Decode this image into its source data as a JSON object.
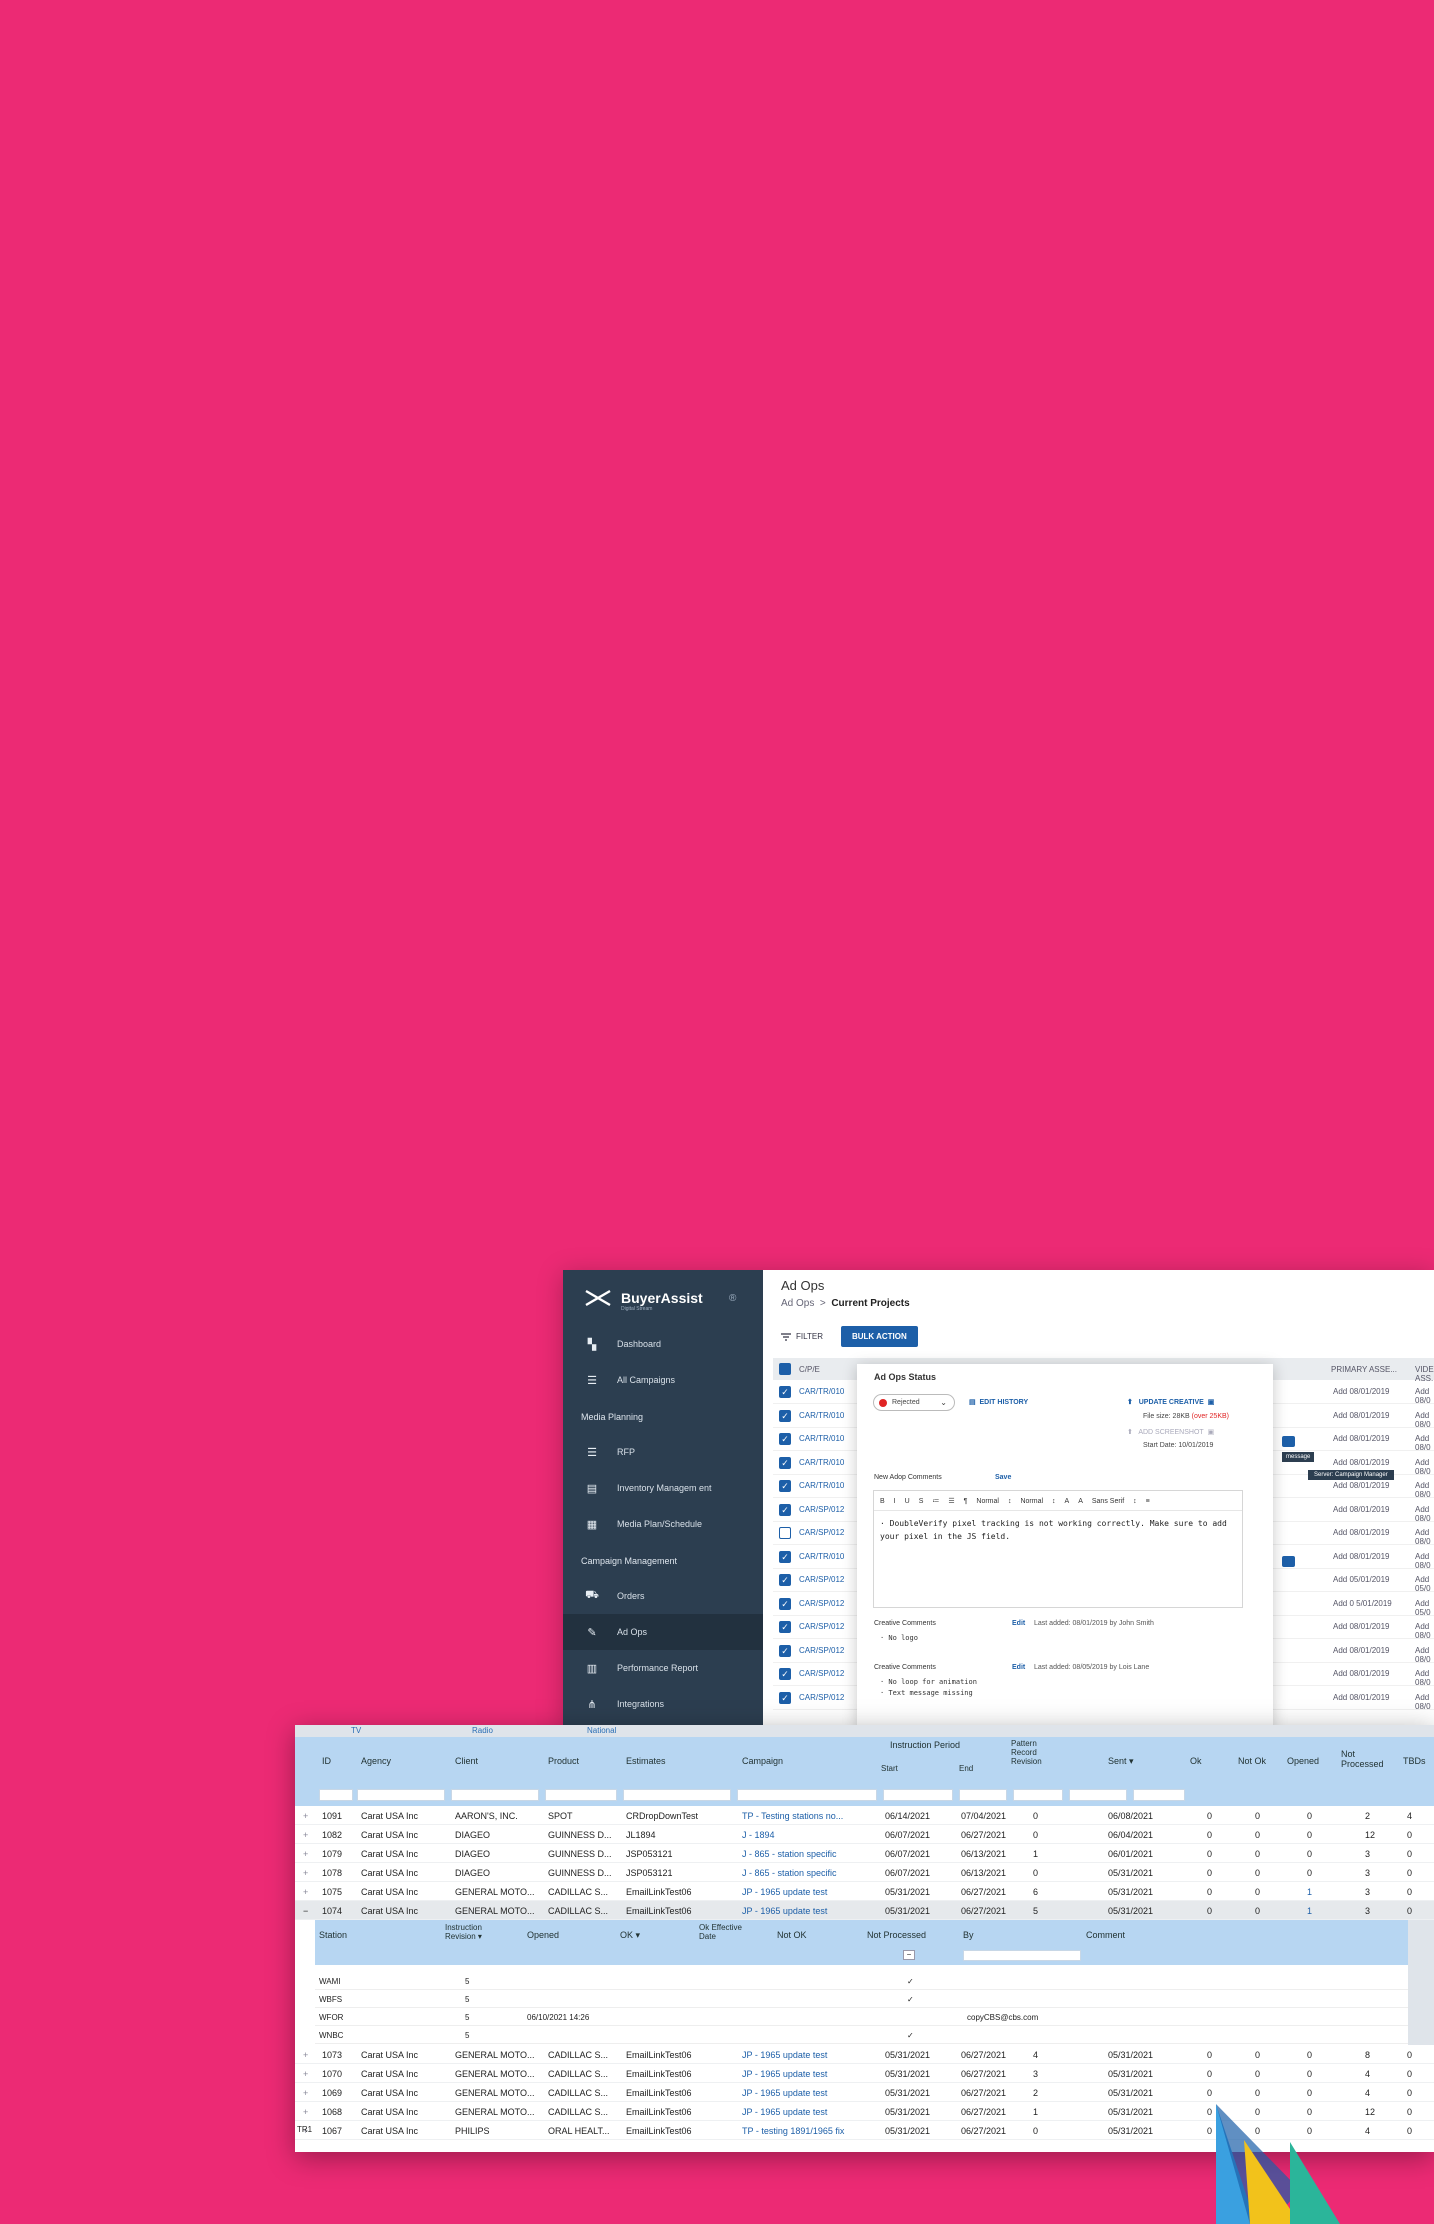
{
  "colors": {
    "background": "#ec2a74",
    "sidebar": "#2c3e50",
    "accent": "#1d5fa8",
    "header_blue": "#b7d6f2",
    "rejected": "#e02424"
  },
  "back_window": {
    "brand": {
      "name": "BuyerAssist",
      "sub": "Digital Stream",
      "help": "®"
    },
    "sidebar": {
      "items_top": [
        {
          "label": "Dashboard",
          "icon": "dashboard-icon",
          "glyph": "▚"
        },
        {
          "label": "All Campaigns",
          "icon": "list-icon",
          "glyph": "☰"
        }
      ],
      "section_planning": "Media Planning",
      "items_planning": [
        {
          "label": "RFP",
          "icon": "list-icon",
          "glyph": "☰"
        },
        {
          "label": "Inventory Managem ent",
          "icon": "clipboard-icon",
          "glyph": "▤"
        },
        {
          "label": "Media Plan/Schedule",
          "icon": "calendar-icon",
          "glyph": "▦"
        }
      ],
      "section_campaign": "Campaign Management",
      "items_campaign": [
        {
          "label": "Orders",
          "icon": "basket-icon",
          "glyph": "⛟"
        },
        {
          "label": "Ad Ops",
          "icon": "adops-icon",
          "glyph": "✎"
        },
        {
          "label": "Performance Report",
          "icon": "report-icon",
          "glyph": "▥"
        },
        {
          "label": "Integrations",
          "icon": "integrations-icon",
          "glyph": "⋔"
        }
      ]
    },
    "title": "Ad Ops",
    "breadcrumb": {
      "parent": "Ad Ops",
      "separator": ">",
      "current": "Current Projects"
    },
    "filter_label": "FILTER",
    "bulk_action_label": "BULK ACTION",
    "columns": {
      "cp": "C/P/E",
      "primary": "PRIMARY ASSE...",
      "video": "VIDEO ASS..."
    },
    "rows": [
      {
        "id": "CAR/TR/010",
        "checked": true,
        "d1": "Add 08/01/2019",
        "d2": "Add 08/0"
      },
      {
        "id": "CAR/TR/010",
        "checked": true,
        "d1": "Add 08/01/2019",
        "d2": "Add 08/0"
      },
      {
        "id": "CAR/TR/010",
        "checked": true,
        "d1": "Add 08/01/2019",
        "d2": "Add 08/0"
      },
      {
        "id": "CAR/TR/010",
        "checked": true,
        "d1": "Add 08/01/2019",
        "d2": "Add 08/0"
      },
      {
        "id": "CAR/TR/010",
        "checked": true,
        "d1": "Add 08/01/2019",
        "d2": "Add 08/0"
      },
      {
        "id": "CAR/SP/012",
        "checked": true,
        "d1": "Add 08/01/2019",
        "d2": "Add 08/0"
      },
      {
        "id": "CAR/SP/012",
        "checked": false,
        "d1": "Add 08/01/2019",
        "d2": "Add 08/0"
      },
      {
        "id": "CAR/TR/010",
        "checked": true,
        "d1": "Add 08/01/2019",
        "d2": "Add 08/0"
      },
      {
        "id": "CAR/SP/012",
        "checked": true,
        "d1": "Add 05/01/2019",
        "d2": "Add 05/0"
      },
      {
        "id": "CAR/SP/012",
        "checked": true,
        "d1": "Add 0 5/01/2019",
        "d2": "Add 05/0"
      },
      {
        "id": "CAR/SP/012",
        "checked": true,
        "d1": "Add 08/01/2019",
        "d2": "Add 08/0"
      },
      {
        "id": "CAR/SP/012",
        "checked": true,
        "d1": "Add 08/01/2019",
        "d2": "Add 08/0"
      },
      {
        "id": "CAR/SP/012",
        "checked": true,
        "d1": "Add 08/01/2019",
        "d2": "Add 08/0"
      },
      {
        "id": "CAR/SP/012",
        "checked": true,
        "d1": "Add 08/01/2019",
        "d2": "Add 08/0"
      }
    ],
    "tooltip_message": "message",
    "tooltip_server": "Server: Campaign Manager",
    "popup": {
      "title": "Ad Ops Status",
      "status": "Rejected",
      "edit_history": "EDIT HISTORY",
      "update_creative": "UPDATE CREATIVE",
      "file_size": "File size: 28KB",
      "file_size_over": "(over 25KB)",
      "add_screenshot": "ADD SCREENSHOT",
      "start_date": "Start Date: 10/01/2019",
      "new_comments_label": "New Adop Comments",
      "save_label": "Save",
      "editor_toolbar": [
        "B",
        "I",
        "U",
        "S",
        "≔",
        "☰",
        "¶",
        "Normal",
        "↕",
        "Normal",
        "↕",
        "A",
        "A",
        "Sans Serif",
        "↕",
        "≡"
      ],
      "editor_text": "· DoubleVerify pixel tracking is not working correctly. Make sure to add your pixel in the JS field.",
      "creative_comments": [
        {
          "label": "Creative Comments",
          "edit": "Edit",
          "added": "Last added: 08/01/2019 by John Smith",
          "items": [
            "· No logo"
          ]
        },
        {
          "label": "Creative Comments",
          "edit": "Edit",
          "added": "Last added: 08/05/2019 by Lois Lane",
          "items": [
            "· No loop for animation",
            "· Text message missing"
          ]
        }
      ]
    }
  },
  "front_window": {
    "tabs": [
      "TV",
      "Radio",
      "National"
    ],
    "headers": {
      "id": "ID",
      "agency": "Agency",
      "client": "Client",
      "product": "Product",
      "estimates": "Estimates",
      "campaign": "Campaign",
      "instruction_period": "Instruction Period",
      "start": "Start",
      "end": "End",
      "pattern": "Pattern Record Revision",
      "sent": "Sent ▾",
      "ok": "Ok",
      "not_ok": "Not Ok",
      "opened": "Opened",
      "not_processed": "Not Processed",
      "tbds": "TBDs"
    },
    "rows_top": [
      {
        "id": "1091",
        "agency": "Carat USA Inc",
        "client": "AARON'S, INC.",
        "product": "SPOT",
        "est": "CRDropDownTest",
        "campaign": "TP - Testing stations no...",
        "start": "06/14/2021",
        "end": "07/04/2021",
        "pattern": "0",
        "sent": "06/08/2021",
        "ok": "0",
        "notok": "0",
        "opened": "0",
        "notproc": "2",
        "tbds": "4"
      },
      {
        "id": "1082",
        "agency": "Carat USA Inc",
        "client": "DIAGEO",
        "product": "GUINNESS D...",
        "est": "JL1894",
        "campaign": "J - 1894",
        "start": "06/07/2021",
        "end": "06/27/2021",
        "pattern": "0",
        "sent": "06/04/2021",
        "ok": "0",
        "notok": "0",
        "opened": "0",
        "notproc": "12",
        "tbds": "0"
      },
      {
        "id": "1079",
        "agency": "Carat USA Inc",
        "client": "DIAGEO",
        "product": "GUINNESS D...",
        "est": "JSP053121",
        "campaign": "J - 865 - station specific",
        "start": "06/07/2021",
        "end": "06/13/2021",
        "pattern": "1",
        "sent": "06/01/2021",
        "ok": "0",
        "notok": "0",
        "opened": "0",
        "notproc": "3",
        "tbds": "0"
      },
      {
        "id": "1078",
        "agency": "Carat USA Inc",
        "client": "DIAGEO",
        "product": "GUINNESS D...",
        "est": "JSP053121",
        "campaign": "J - 865 - station specific",
        "start": "06/07/2021",
        "end": "06/13/2021",
        "pattern": "0",
        "sent": "05/31/2021",
        "ok": "0",
        "notok": "0",
        "opened": "0",
        "notproc": "3",
        "tbds": "0"
      },
      {
        "id": "1075",
        "agency": "Carat USA Inc",
        "client": "GENERAL MOTO...",
        "product": "CADILLAC S...",
        "est": "EmailLinkTest06",
        "campaign": "JP - 1965 update test",
        "start": "05/31/2021",
        "end": "06/27/2021",
        "pattern": "6",
        "sent": "05/31/2021",
        "ok": "0",
        "notok": "0",
        "opened": "1",
        "notproc": "3",
        "tbds": "0"
      },
      {
        "id": "1074",
        "agency": "Carat USA Inc",
        "client": "GENERAL MOTO...",
        "product": "CADILLAC S...",
        "est": "EmailLinkTest06",
        "campaign": "JP - 1965 update test",
        "start": "05/31/2021",
        "end": "06/27/2021",
        "pattern": "5",
        "sent": "05/31/2021",
        "ok": "0",
        "notok": "0",
        "opened": "1",
        "notproc": "3",
        "tbds": "0"
      }
    ],
    "sub_headers": {
      "station": "Station",
      "revision": "Instruction Revision ▾",
      "opened": "Opened",
      "ok": "OK ▾",
      "ok_effective": "Ok Effective Date",
      "not_ok": "Not OK",
      "not_processed": "Not Processed",
      "by": "By",
      "comment": "Comment"
    },
    "sub_rows": [
      {
        "station": "WAMI",
        "rev": "5",
        "opened": "",
        "np": "✓",
        "by": ""
      },
      {
        "station": "WBFS",
        "rev": "5",
        "opened": "",
        "np": "✓",
        "by": ""
      },
      {
        "station": "WFOR",
        "rev": "5",
        "opened": "06/10/2021 14:26",
        "np": "",
        "by": "copyCBS@cbs.com"
      },
      {
        "station": "WNBC",
        "rev": "5",
        "opened": "",
        "np": "✓",
        "by": ""
      }
    ],
    "rows_bottom": [
      {
        "id": "1073",
        "agency": "Carat USA Inc",
        "client": "GENERAL MOTO...",
        "product": "CADILLAC S...",
        "est": "EmailLinkTest06",
        "campaign": "JP - 1965 update test",
        "start": "05/31/2021",
        "end": "06/27/2021",
        "pattern": "4",
        "sent": "05/31/2021",
        "ok": "0",
        "notok": "0",
        "opened": "0",
        "notproc": "8",
        "tbds": "0"
      },
      {
        "id": "1070",
        "agency": "Carat USA Inc",
        "client": "GENERAL MOTO...",
        "product": "CADILLAC S...",
        "est": "EmailLinkTest06",
        "campaign": "JP - 1965 update test",
        "start": "05/31/2021",
        "end": "06/27/2021",
        "pattern": "3",
        "sent": "05/31/2021",
        "ok": "0",
        "notok": "0",
        "opened": "0",
        "notproc": "4",
        "tbds": "0"
      },
      {
        "id": "1069",
        "agency": "Carat USA Inc",
        "client": "GENERAL MOTO...",
        "product": "CADILLAC S...",
        "est": "EmailLinkTest06",
        "campaign": "JP - 1965 update test",
        "start": "05/31/2021",
        "end": "06/27/2021",
        "pattern": "2",
        "sent": "05/31/2021",
        "ok": "0",
        "notok": "0",
        "opened": "0",
        "notproc": "4",
        "tbds": "0"
      },
      {
        "id": "1068",
        "agency": "Carat USA Inc",
        "client": "GENERAL MOTO...",
        "product": "CADILLAC S...",
        "est": "EmailLinkTest06",
        "campaign": "JP - 1965 update test",
        "start": "05/31/2021",
        "end": "06/27/2021",
        "pattern": "1",
        "sent": "05/31/2021",
        "ok": "0",
        "notok": "0",
        "opened": "0",
        "notproc": "12",
        "tbds": "0"
      },
      {
        "id": "1067",
        "agency": "Carat USA Inc",
        "client": "PHILIPS",
        "product": "ORAL HEALT...",
        "est": "EmailLinkTest06",
        "campaign": "TP - testing 1891/1965 fix",
        "start": "05/31/2021",
        "end": "06/27/2021",
        "pattern": "0",
        "sent": "05/31/2021",
        "ok": "0",
        "notok": "0",
        "opened": "0",
        "notproc": "4",
        "tbds": "0"
      }
    ],
    "footer_label": "TR1"
  }
}
